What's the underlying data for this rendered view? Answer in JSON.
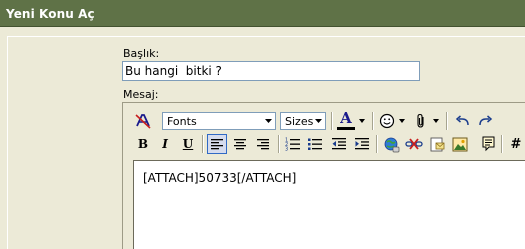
{
  "window": {
    "title": "Yeni Konu Aç"
  },
  "form": {
    "subject_label": "Başlık:",
    "subject_value": "Bu hangi  bitki ?",
    "message_label": "Mesaj:",
    "message_value": "[ATTACH]50733[/ATTACH]"
  },
  "toolbar": {
    "font_select": "Fonts",
    "size_select": "Sizes",
    "font_color_glyph": "A",
    "bold_glyph": "B",
    "italic_glyph": "I",
    "underline_glyph": "U",
    "hash_glyph": "#"
  },
  "colors": {
    "title_bar": "#5f7247",
    "panel": "#ecead7",
    "accent_active": "#316ac5",
    "font_color_bar": "#000000"
  }
}
